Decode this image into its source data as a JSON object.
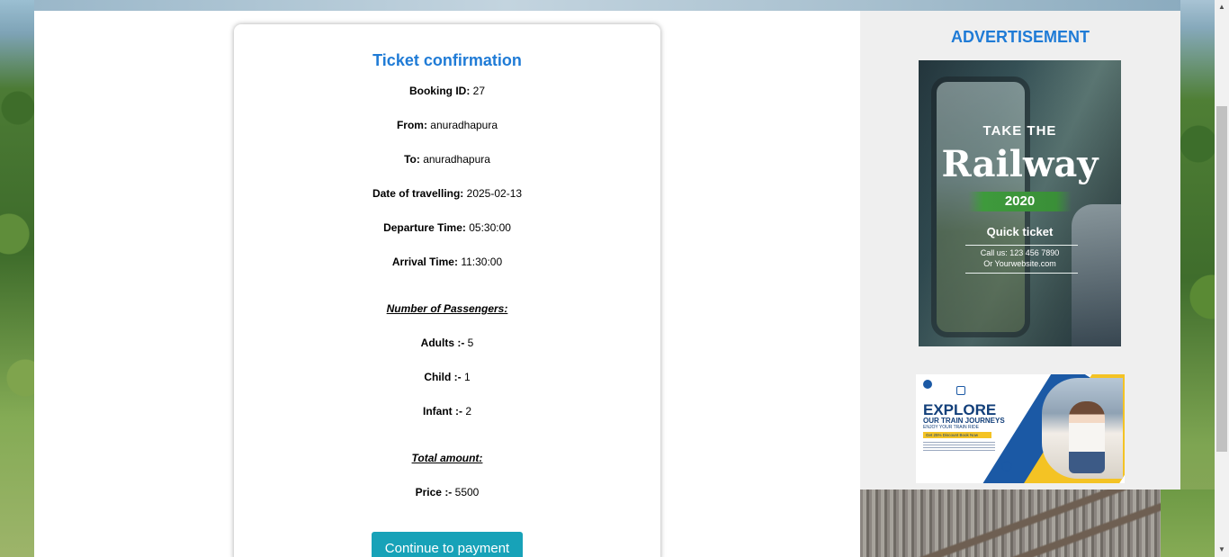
{
  "ticket": {
    "title": "Ticket confirmation",
    "booking_id_label": "Booking ID:",
    "booking_id": "27",
    "from_label": "From:",
    "from": "anuradhapura",
    "to_label": "To:",
    "to": "anuradhapura",
    "date_label": "Date of travelling:",
    "date": "2025-02-13",
    "departure_label": "Departure Time:",
    "departure": "05:30:00",
    "arrival_label": "Arrival Time:",
    "arrival": "11:30:00",
    "passengers_heading": "Number of Passengers:",
    "adults_label": "Adults :-",
    "adults": "5",
    "child_label": "Child :-",
    "child": "1",
    "infant_label": "Infant :-",
    "infant": "2",
    "total_heading": "Total amount:",
    "price_label": "Price :-",
    "price": "5500",
    "continue_button": "Continue to payment"
  },
  "ads": {
    "heading": "ADVERTISEMENT",
    "railway": {
      "line1": "TAKE THE",
      "line2": "Railway",
      "year": "2020",
      "line3": "Quick ticket",
      "phone": "Call us: 123 456 7890",
      "website": "Or Yourwebsite.com"
    },
    "explore": {
      "title": "EXPLORE",
      "subtitle": "OUR TRAIN JOURNEYS",
      "tagline": "ENJOY YOUR TRAIN RIDE",
      "discount": "Get 25% Discount Book Now"
    }
  },
  "colors": {
    "accent": "#1f7bd6",
    "button": "#17a2b8",
    "ad_background": "#efefef"
  },
  "icons": {
    "scroll_up": "▲",
    "scroll_down": "▼"
  }
}
